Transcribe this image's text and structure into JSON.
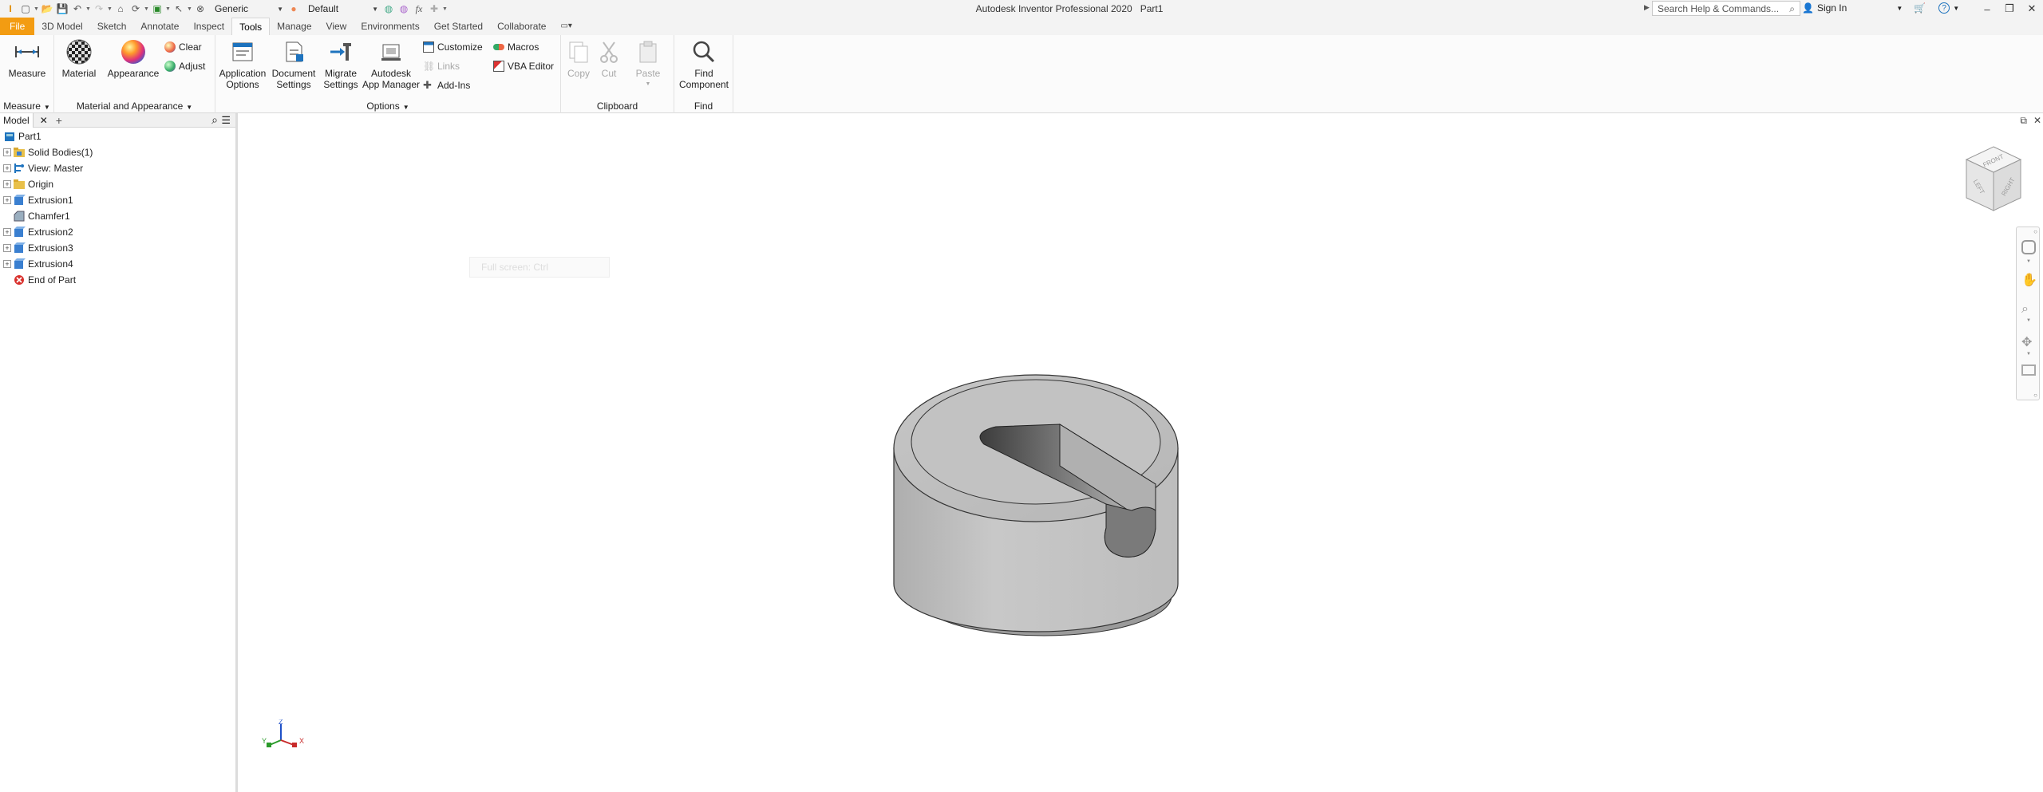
{
  "title_bar": {
    "app_title": "Autodesk Inventor Professional 2020",
    "document": "Part1",
    "material_combo": "Generic",
    "appearance_combo": "Default",
    "search_placeholder": "Search Help & Commands...",
    "sign_in": "Sign In"
  },
  "tabs": [
    "File",
    "3D Model",
    "Sketch",
    "Annotate",
    "Inspect",
    "Tools",
    "Manage",
    "View",
    "Environments",
    "Get Started",
    "Collaborate"
  ],
  "active_tab": "Tools",
  "ribbon": {
    "measure": {
      "button": "Measure",
      "panel": "Measure"
    },
    "material_appearance": {
      "material": "Material",
      "appearance": "Appearance",
      "clear": "Clear",
      "adjust": "Adjust",
      "panel": "Material and Appearance"
    },
    "options": {
      "app_options_l1": "Application",
      "app_options_l2": "Options",
      "doc_settings_l1": "Document",
      "doc_settings_l2": "Settings",
      "migrate_l1": "Migrate",
      "migrate_l2": "Settings",
      "app_manager_l1": "Autodesk",
      "app_manager_l2": "App Manager",
      "customize": "Customize",
      "links": "Links",
      "add_ins": "Add-Ins",
      "macros": "Macros",
      "vba_editor": "VBA Editor",
      "panel": "Options"
    },
    "clipboard": {
      "copy": "Copy",
      "cut": "Cut",
      "paste": "Paste",
      "panel": "Clipboard"
    },
    "find": {
      "find_l1": "Find",
      "find_l2": "Component",
      "panel": "Find"
    }
  },
  "browser": {
    "tab": "Model",
    "items": [
      {
        "label": "Part1",
        "icon": "part-icon",
        "expand": "none"
      },
      {
        "label": "Solid Bodies(1)",
        "icon": "solid-bodies-folder-icon",
        "expand": "plus"
      },
      {
        "label": "View: Master",
        "icon": "view-rep-icon",
        "expand": "plus"
      },
      {
        "label": "Origin",
        "icon": "origin-folder-icon",
        "expand": "plus"
      },
      {
        "label": "Extrusion1",
        "icon": "extrusion-icon",
        "expand": "plus"
      },
      {
        "label": "Chamfer1",
        "icon": "chamfer-icon",
        "expand": "none"
      },
      {
        "label": "Extrusion2",
        "icon": "extrusion-icon",
        "expand": "plus"
      },
      {
        "label": "Extrusion3",
        "icon": "extrusion-icon",
        "expand": "plus"
      },
      {
        "label": "Extrusion4",
        "icon": "extrusion-icon",
        "expand": "plus"
      },
      {
        "label": "End of Part",
        "icon": "end-of-part-icon",
        "expand": "none"
      }
    ]
  },
  "viewport": {
    "full_screen_tip": "Full screen: Ctrl",
    "viewcube_faces": [
      "FRONT",
      "RIGHT",
      "LEFT"
    ],
    "triad_axes": [
      "Z",
      "Y",
      "X"
    ]
  },
  "colors": {
    "file_tab": "#f39c12",
    "accent_blue": "#1e73be",
    "error_red": "#d9302c"
  }
}
